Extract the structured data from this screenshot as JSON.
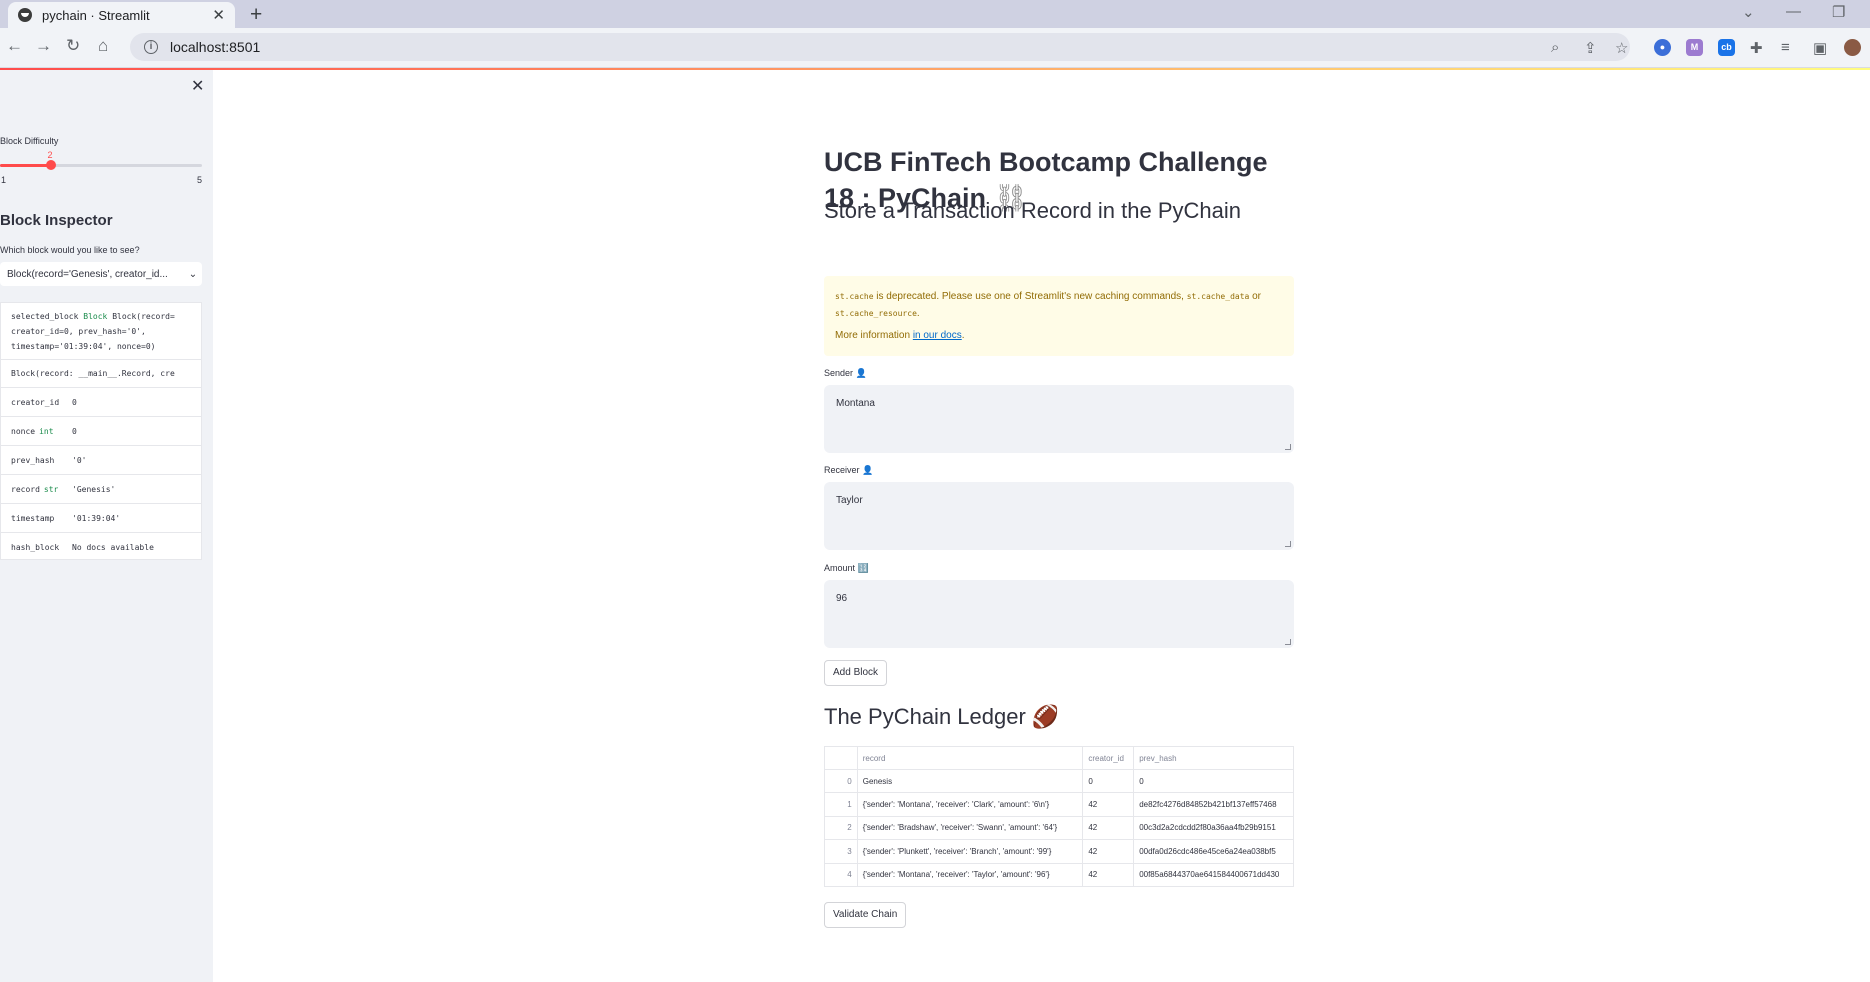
{
  "browser": {
    "tab_title": "pychain · Streamlit",
    "url": "localhost:8501"
  },
  "sidebar": {
    "difficulty_label": "Block Difficulty",
    "difficulty_value": "2",
    "difficulty_min": "1",
    "difficulty_max": "5",
    "difficulty_fraction": 0.25,
    "inspector_title": "Block Inspector",
    "select_label": "Which block would you like to see?",
    "select_value": "Block(record='Genesis', creator_id...",
    "inspect_line1_name": "selected_block",
    "inspect_line1_type": "Block",
    "inspect_line1_rest": "Block(record=",
    "inspect_line2": "creator_id=0, prev_hash='0',",
    "inspect_line3": "timestamp='01:39:04', nonce=0)",
    "inspect_repr": "Block(record: __main__.Record, cre",
    "inspect_rows": [
      {
        "name": "creator_id",
        "type": "",
        "value": "0"
      },
      {
        "name": "nonce",
        "type": "int",
        "value": "0"
      },
      {
        "name": "prev_hash",
        "type": "",
        "value": "'0'"
      },
      {
        "name": "record",
        "type": "str",
        "value": "'Genesis'"
      },
      {
        "name": "timestamp",
        "type": "",
        "value": "'01:39:04'"
      },
      {
        "name": "hash_block",
        "type": "",
        "value": "No docs available"
      }
    ]
  },
  "main": {
    "title": "UCB FinTech Bootcamp Challenge 18 : PyChain",
    "title_emoji": "⛓",
    "store_heading": "Store a Transaction Record in the PyChain",
    "warning": {
      "code1": "st.cache",
      "text1": " is deprecated. Please use one of Streamlit's new caching commands, ",
      "code2": "st.cache_data",
      "text2": " or ",
      "code3": "st.cache_resource",
      "text3": ".",
      "more": "More information ",
      "link": "in our docs",
      "end": "."
    },
    "sender_label": "Sender",
    "sender_value": "Montana",
    "receiver_label": "Receiver",
    "receiver_value": "Taylor",
    "amount_label": "Amount",
    "amount_value": "96",
    "add_block_label": "Add Block",
    "ledger_heading": "The PyChain Ledger",
    "ledger_emoji": "🏈",
    "ledger_columns": [
      "",
      "record",
      "creator_id",
      "prev_hash"
    ],
    "ledger_rows": [
      [
        "0",
        "Genesis",
        "0",
        "0"
      ],
      [
        "1",
        "{'sender': 'Montana', 'receiver': 'Clark', 'amount': '6\\n'}",
        "42",
        "de82fc4276d84852b421bf137eff57468"
      ],
      [
        "2",
        "{'sender': 'Bradshaw', 'receiver': 'Swann', 'amount': '64'}",
        "42",
        "00c3d2a2cdcdd2f80a36aa4fb29b9151"
      ],
      [
        "3",
        "{'sender': 'Plunkett', 'receiver': 'Branch', 'amount': '99'}",
        "42",
        "00dfa0d26cdc486e45ce6a24ea038bf5"
      ],
      [
        "4",
        "{'sender': 'Montana', 'receiver': 'Taylor', 'amount': '96'}",
        "42",
        "00f85a6844370ae641584400671dd430"
      ]
    ],
    "validate_label": "Validate Chain"
  },
  "colors": {
    "accent": "#ff4b4b",
    "sidebar_bg": "#f0f2f6",
    "warning_bg": "#fffce7",
    "link": "#0068c9"
  }
}
